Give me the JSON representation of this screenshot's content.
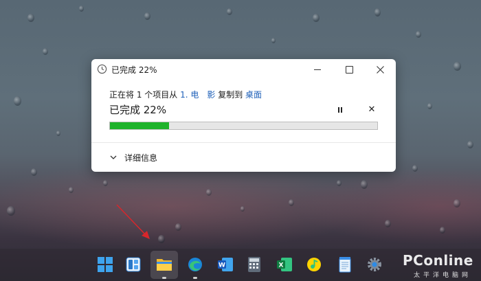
{
  "dialog": {
    "window_title": "已完成 22%",
    "copy_prefix": "正在将 1 个项目从",
    "source_name": "1. 电　影",
    "copy_verb": "复制到",
    "destination_name": "桌面",
    "status": "已完成 22%",
    "progress_fraction": 0.22,
    "cancel_symbol": "✕",
    "details_label": "详细信息"
  },
  "colors": {
    "progress_fill": "#1fb32b",
    "link": "#1d5fb8"
  },
  "taskbar": {
    "icons": [
      "windows-start-icon",
      "widgets-icon",
      "file-explorer-icon",
      "edge-browser-icon",
      "word-icon",
      "calculator-icon",
      "excel-icon",
      "qq-music-icon",
      "notepad-icon",
      "settings-icon"
    ],
    "active_app": "file-explorer-icon"
  },
  "watermark": {
    "brand": "PConline",
    "tagline": "太平洋电脑网"
  }
}
